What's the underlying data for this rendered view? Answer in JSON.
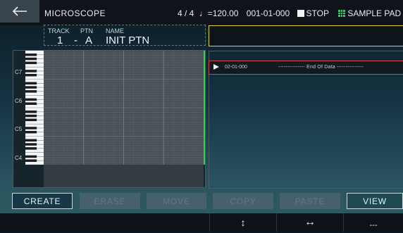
{
  "header": {
    "title": "MICROSCOPE",
    "time_signature": "4 / 4",
    "tempo": "♩=120.00",
    "position": "001-01-000",
    "transport": "STOP",
    "mode": "SAMPLE PAD"
  },
  "track_info": {
    "track_label": "TRACK",
    "track_value": "1",
    "separator": "-",
    "ptn_label": "PTN",
    "ptn_value": "A",
    "name_label": "NAME",
    "name_value": "INIT PTN"
  },
  "piano": {
    "octave_labels": [
      "C7",
      "C6",
      "C5",
      "C4"
    ]
  },
  "event_list": {
    "rows": [
      {
        "position": "02-01-000",
        "text": "--------------- End Of Data ---------------"
      }
    ]
  },
  "buttons": {
    "create": "CREATE",
    "erase": "ERASE",
    "move": "MOVE",
    "copy": "COPY",
    "paste": "PASTE",
    "view": "VIEW"
  },
  "bottom_bar": {
    "vertical_icon": "↕",
    "horizontal_icon": "↔",
    "dashes": "---"
  },
  "colors": {
    "accent_green": "#2fd14a",
    "highlight_yellow": "#e4d23a",
    "selection_red": "#d8454a",
    "pad_green": "#35c86b"
  },
  "icons": {
    "back": "back-arrow-icon",
    "stop": "stop-square-icon",
    "pad": "sample-pad-grid-icon",
    "play": "play-triangle-icon",
    "vertical": "vertical-arrows-icon",
    "horizontal": "horizontal-arrows-icon"
  }
}
